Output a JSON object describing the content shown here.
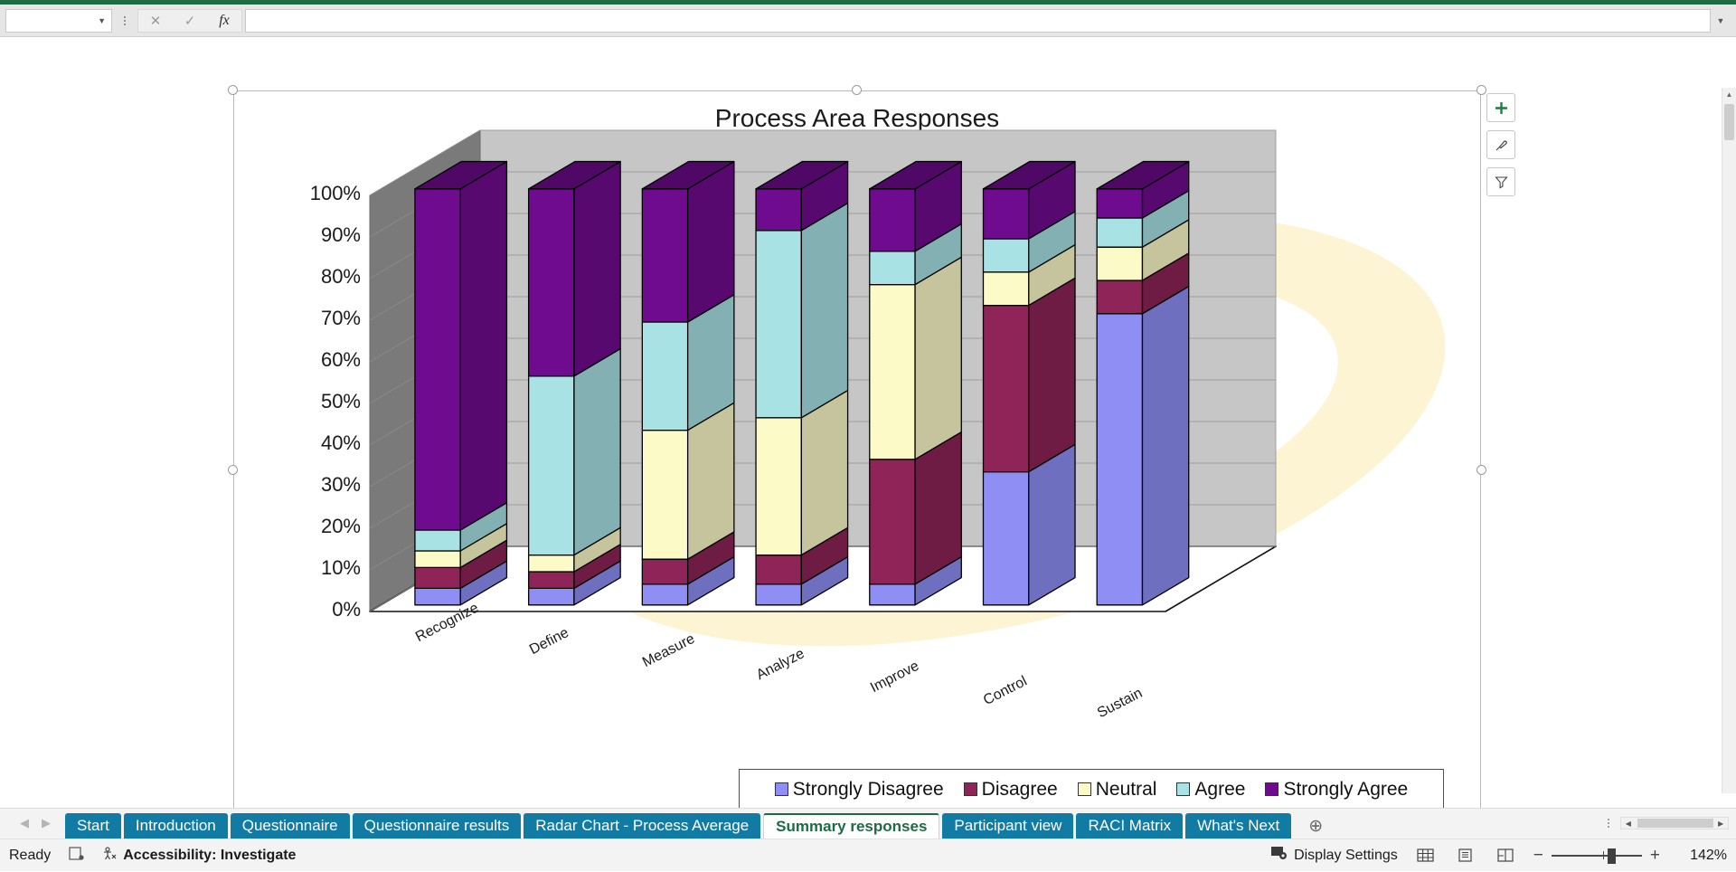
{
  "formula_bar": {
    "name_box_value": "",
    "name_box_icon": "chevron-down-icon",
    "cancel_icon": "close-icon",
    "confirm_icon": "check-icon",
    "function_icon": "fx-icon",
    "formula_value": "",
    "expand_icon": "chevron-down-icon"
  },
  "chart": {
    "title": "Process Area Responses",
    "tools": [
      {
        "name": "chart-elements-button",
        "icon": "plus-icon"
      },
      {
        "name": "chart-styles-button",
        "icon": "brush-icon"
      },
      {
        "name": "chart-filters-button",
        "icon": "funnel-icon"
      }
    ],
    "colors": {
      "strongly_disagree": "#8e8ef5",
      "disagree": "#8e2457",
      "neutral": "#fcfbc8",
      "agree": "#a8e2e4",
      "strongly_agree": "#6f0b8e",
      "wall": "#c6c6c6",
      "wall_side": "#7a7a7a",
      "floor": "#ffffff",
      "blob": "#fdf4d4"
    }
  },
  "chart_data": {
    "type": "bar",
    "title": "Process Area Responses",
    "xlabel": "",
    "ylabel": "",
    "ylim": [
      0,
      100
    ],
    "ytick_labels": [
      "0%",
      "10%",
      "20%",
      "30%",
      "40%",
      "50%",
      "60%",
      "70%",
      "80%",
      "90%",
      "100%"
    ],
    "ytick_values": [
      0,
      10,
      20,
      30,
      40,
      50,
      60,
      70,
      80,
      90,
      100
    ],
    "grid": true,
    "stacked": true,
    "three_d": true,
    "legend_position": "bottom",
    "categories": [
      "Recognize",
      "Define",
      "Measure",
      "Analyze",
      "Improve",
      "Control",
      "Sustain"
    ],
    "series": [
      {
        "name": "Strongly Disagree",
        "color": "#8e8ef5",
        "values": [
          4,
          4,
          5,
          5,
          5,
          32,
          70
        ]
      },
      {
        "name": "Disagree",
        "color": "#8e2457",
        "values": [
          5,
          4,
          6,
          7,
          30,
          40,
          8
        ]
      },
      {
        "name": "Neutral",
        "color": "#fcfbc8",
        "values": [
          4,
          4,
          31,
          33,
          42,
          8,
          8
        ]
      },
      {
        "name": "Agree",
        "color": "#a8e2e4",
        "values": [
          5,
          43,
          26,
          45,
          8,
          8,
          7
        ]
      },
      {
        "name": "Strongly Agree",
        "color": "#6f0b8e",
        "values": [
          82,
          45,
          32,
          10,
          15,
          12,
          7
        ]
      }
    ]
  },
  "legend": {
    "items": [
      {
        "label": "Strongly Disagree",
        "color": "#8e8ef5"
      },
      {
        "label": "Disagree",
        "color": "#8e2457"
      },
      {
        "label": "Neutral",
        "color": "#fcfbc8"
      },
      {
        "label": "Agree",
        "color": "#a8e2e4"
      },
      {
        "label": "Strongly Agree",
        "color": "#6f0b8e"
      }
    ]
  },
  "sheet_tabs": {
    "prev_icon": "chevron-left-icon",
    "next_icon": "chevron-right-icon",
    "add_icon": "plus-circle-icon",
    "tabs": [
      {
        "label": "Start",
        "active": false
      },
      {
        "label": "Introduction",
        "active": false
      },
      {
        "label": "Questionnaire",
        "active": false
      },
      {
        "label": "Questionnaire results",
        "active": false
      },
      {
        "label": "Radar Chart - Process Average",
        "active": false
      },
      {
        "label": "Summary responses",
        "active": true
      },
      {
        "label": "Participant view",
        "active": false
      },
      {
        "label": "RACI Matrix",
        "active": false
      },
      {
        "label": "What's Next",
        "active": false
      }
    ]
  },
  "status_bar": {
    "state": "Ready",
    "macro_icon": "record-macro-icon",
    "accessibility_icon": "accessibility-icon",
    "accessibility_text": "Accessibility: Investigate",
    "display_settings_icon": "display-settings-icon",
    "display_settings_text": "Display Settings",
    "views": [
      {
        "name": "normal-view-button",
        "icon": "grid-icon"
      },
      {
        "name": "page-layout-view-button",
        "icon": "page-icon"
      },
      {
        "name": "page-break-preview-button",
        "icon": "pagebreak-icon"
      }
    ],
    "zoom_out_icon": "minus-icon",
    "zoom_in_icon": "plus-icon",
    "zoom_level": "142%"
  }
}
